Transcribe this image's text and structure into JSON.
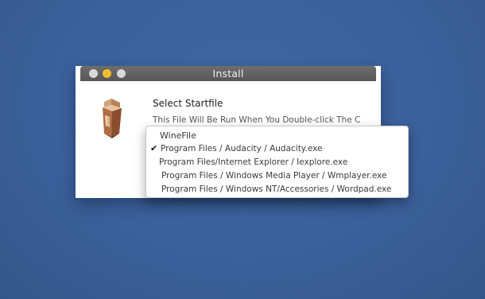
{
  "window": {
    "title": "Install"
  },
  "dialog": {
    "heading": "Select Startfile",
    "description": "This File Will Be Run When You Double-click The Created"
  },
  "dropdown": {
    "options": [
      {
        "label": "WineFile",
        "checked": false
      },
      {
        "label": "Program Files / Audacity / Audacity.exe",
        "checked": true
      },
      {
        "label": "Program Files/Internet Explorer / Iexplore.exe",
        "checked": false
      },
      {
        "label": "Program Files / Windows Media Player / Wmplayer.exe",
        "checked": false
      },
      {
        "label": "Program Files / Windows NT/Accessories / Wordpad.exe",
        "checked": false
      }
    ],
    "check_glyph": "✔"
  },
  "icons": {
    "app": "package-box-icon"
  },
  "colors": {
    "desktop": "#3a5f97",
    "titlebar": "#5f5f5f",
    "minimize": "#f5bd2e"
  }
}
